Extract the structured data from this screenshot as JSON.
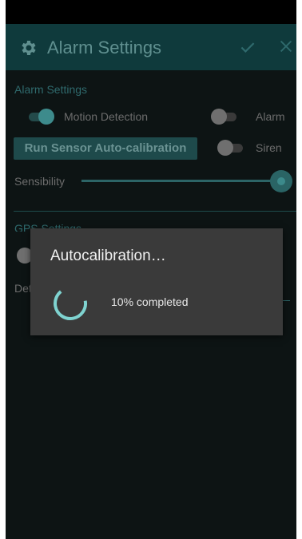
{
  "appbar": {
    "title": "Alarm Settings",
    "icons": [
      "gear-icon",
      "check-icon",
      "close-icon"
    ]
  },
  "alarm_section": {
    "title": "Alarm Settings",
    "motion_detection": {
      "label": "Motion Detection",
      "on": true
    },
    "alarm": {
      "label": "Alarm",
      "on": false
    },
    "run_button": "Run Sensor Auto-calibration",
    "siren": {
      "label": "Siren",
      "on": false
    },
    "sensibility": {
      "label": "Sensibility",
      "level_fraction": 1.0
    }
  },
  "gps_section": {
    "title_visible_fragment": "GPS Settings",
    "row_label_fragment": "Det"
  },
  "dialog": {
    "title": "Autocalibration…",
    "message": "10% completed",
    "progress_percent": 10
  },
  "colors": {
    "accent": "#3d8b8c",
    "appbar": "#0f3a3c",
    "dialog_bg": "#3a3a3a",
    "spinner": "#7fd3d0"
  }
}
